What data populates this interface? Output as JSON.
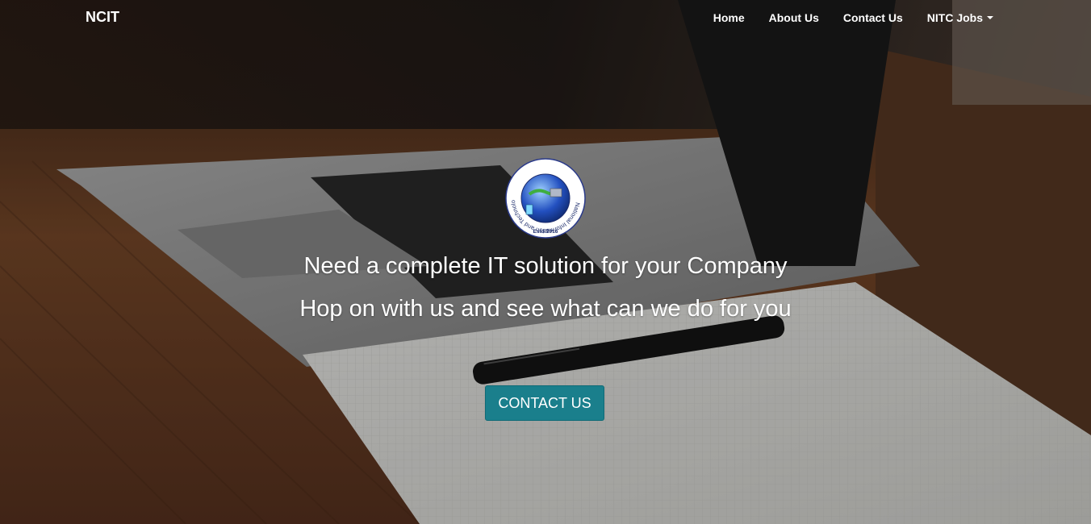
{
  "navbar": {
    "brand": "NCIT",
    "items": [
      {
        "label": "Home"
      },
      {
        "label": "About Us"
      },
      {
        "label": "Contact Us"
      },
      {
        "label": "NITC Jobs",
        "dropdown": true,
        "icon": "caret-down-icon"
      }
    ]
  },
  "logo": {
    "ring_text": "National Information and Technology Corporation",
    "established": "Estd:2016"
  },
  "hero": {
    "headline": "Need a complete IT solution for your Company",
    "subheadline": "Hop on with us and see what can we do for you",
    "cta_label": "CONTACT US"
  },
  "colors": {
    "cta": "#1a7f8c",
    "wood": "#7a4a2a",
    "laptop": "#9a9a9a"
  }
}
